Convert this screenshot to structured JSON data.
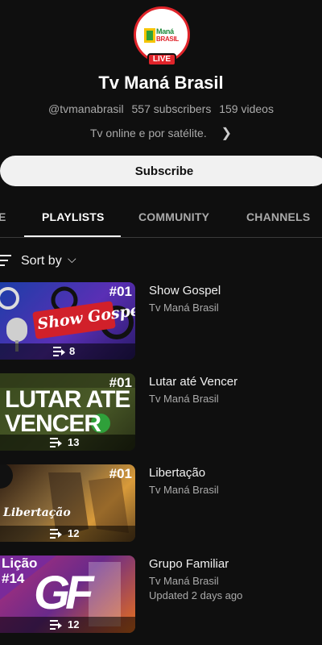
{
  "channel": {
    "logo_line1": "Maná",
    "logo_line2": "BRASIL",
    "live_label": "LIVE",
    "name": "Tv Maná Brasil",
    "handle": "@tvmanabrasil",
    "subscribers": "557 subscribers",
    "videos": "159 videos",
    "description": "Tv online e por satélite.",
    "subscribe_label": "Subscribe"
  },
  "tabs": [
    {
      "label": "E",
      "active": false
    },
    {
      "label": "PLAYLISTS",
      "active": true
    },
    {
      "label": "COMMUNITY",
      "active": false
    },
    {
      "label": "CHANNELS",
      "active": false
    }
  ],
  "sort": {
    "label": "Sort by"
  },
  "playlists": [
    {
      "title": "Show Gospel",
      "channel": "Tv Maná Brasil",
      "updated": "",
      "count": "8",
      "thumb_tag": "#01",
      "thumb_text": "Show Gospel"
    },
    {
      "title": "Lutar até Vencer",
      "channel": "Tv Maná Brasil",
      "updated": "",
      "count": "13",
      "thumb_tag": "#01",
      "thumb_text": "LUTAR ATE VENCER"
    },
    {
      "title": "Libertação",
      "channel": "Tv Maná Brasil",
      "updated": "",
      "count": "12",
      "thumb_tag": "#01",
      "thumb_text": "Libertação"
    },
    {
      "title": "Grupo Familiar",
      "channel": "Tv Maná Brasil",
      "updated": "Updated 2 days ago",
      "count": "12",
      "thumb_tag": "Lição #14",
      "thumb_text": "GF"
    }
  ],
  "colors": {
    "background": "#0f0f0f",
    "live_red": "#e0242a",
    "text_primary": "#f1f1f1",
    "text_secondary": "#aaaaaa"
  },
  "icons": [
    "sort-icon",
    "chevron-down-icon",
    "chevron-right-icon",
    "playlist-icon"
  ]
}
